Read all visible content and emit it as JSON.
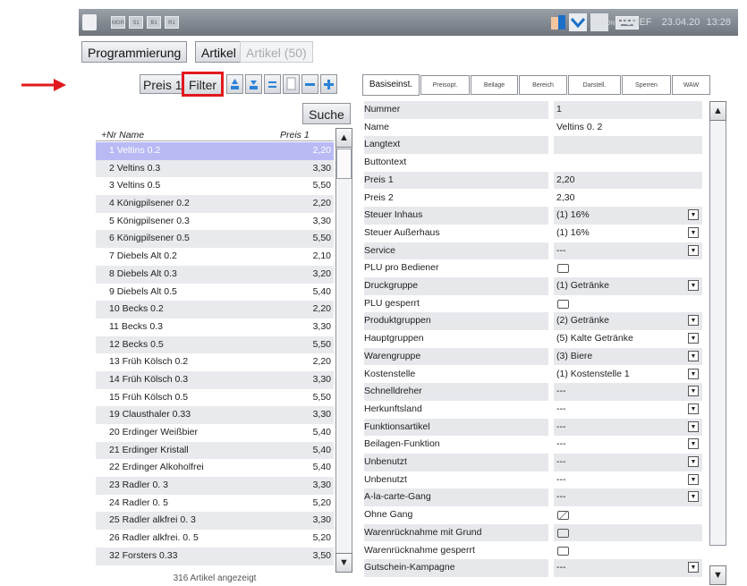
{
  "topbar": {
    "small_buttons": [
      "MGR",
      "S1",
      "B1",
      "R1"
    ],
    "net_label": "NET ON",
    "user": "CHEF",
    "date": "23.04.20",
    "time": "13:28"
  },
  "tabs": {
    "programmierung": "Programmierung",
    "artikel": "Artikel",
    "artikel_count": "Artikel (50)"
  },
  "toolbar": {
    "preis_label": "Preis 1",
    "filter_label": "Filter",
    "search_label": "Suche"
  },
  "list": {
    "col_nr_name": "+Nr Name",
    "col_price": "Preis 1",
    "items": [
      {
        "text": "1 Veltins 0.2",
        "price": "2,20"
      },
      {
        "text": "2 Veltins 0.3",
        "price": "3,30"
      },
      {
        "text": "3 Veltins 0.5",
        "price": "5,50"
      },
      {
        "text": "4 Königpilsener 0.2",
        "price": "2,20"
      },
      {
        "text": "5 Königpilsener 0.3",
        "price": "3,30"
      },
      {
        "text": "6 Königpilsener 0.5",
        "price": "5,50"
      },
      {
        "text": "7 Diebels Alt 0.2",
        "price": "2,10"
      },
      {
        "text": "8 Diebels Alt 0.3",
        "price": "3,20"
      },
      {
        "text": "9 Diebels Alt 0.5",
        "price": "5,40"
      },
      {
        "text": "10 Becks 0.2",
        "price": "2,20"
      },
      {
        "text": "11 Becks 0.3",
        "price": "3,30"
      },
      {
        "text": "12 Becks 0.5",
        "price": "5,50"
      },
      {
        "text": "13 Früh Kölsch 0.2",
        "price": "2,20"
      },
      {
        "text": "14 Früh Kölsch 0.3",
        "price": "3,30"
      },
      {
        "text": "15 Früh Kölsch 0.5",
        "price": "5,50"
      },
      {
        "text": "19 Clausthaler 0.33",
        "price": "3,30"
      },
      {
        "text": "20 Erdinger Weißbier",
        "price": "5,40"
      },
      {
        "text": "21 Erdinger Kristall",
        "price": "5,40"
      },
      {
        "text": "22 Erdinger Alkoholfrei",
        "price": "5,40"
      },
      {
        "text": "23 Radler 0. 3",
        "price": "3,30"
      },
      {
        "text": "24 Radler 0. 5",
        "price": "5,20"
      },
      {
        "text": "25 Radler alkfrei 0. 3",
        "price": "3,30"
      },
      {
        "text": "26 Radler alkfrei. 0. 5",
        "price": "5,20"
      },
      {
        "text": "32 Forsters 0.33",
        "price": "3,50"
      }
    ],
    "footer": "316 Artikel angezeigt"
  },
  "detail": {
    "tabs": [
      "Basiseinst.",
      "Preisopt.",
      "Beilage",
      "Bereich",
      "Darstell.",
      "Sperren",
      "WAW"
    ],
    "rows": [
      {
        "label": "Nummer",
        "value": "1",
        "type": "text"
      },
      {
        "label": "Name",
        "value": "Veltins 0. 2",
        "type": "text"
      },
      {
        "label": "Langtext",
        "value": "",
        "type": "text"
      },
      {
        "label": "Buttontext",
        "value": "",
        "type": "text"
      },
      {
        "label": "Preis 1",
        "value": "2,20",
        "type": "text"
      },
      {
        "label": "Preis 2",
        "value": "2,30",
        "type": "text"
      },
      {
        "label": "Steuer Inhaus",
        "value": "(1) 16%",
        "type": "dropdown"
      },
      {
        "label": "Steuer Außerhaus",
        "value": "(1) 16%",
        "type": "dropdown"
      },
      {
        "label": "Service",
        "value": "---",
        "type": "dropdown"
      },
      {
        "label": "PLU pro Bediener",
        "value": "",
        "type": "checkbox"
      },
      {
        "label": "Druckgruppe",
        "value": "(1) Getränke",
        "type": "dropdown"
      },
      {
        "label": "PLU gesperrt",
        "value": "",
        "type": "checkbox"
      },
      {
        "label": "Produktgruppen",
        "value": "(2) Getränke",
        "type": "dropdown"
      },
      {
        "label": "Hauptgruppen",
        "value": "(5) Kalte Getränke",
        "type": "dropdown"
      },
      {
        "label": "Warengruppe",
        "value": "(3) Biere",
        "type": "dropdown"
      },
      {
        "label": "Kostenstelle",
        "value": "(1) Kostenstelle 1",
        "type": "dropdown"
      },
      {
        "label": "Schnelldreher",
        "value": "---",
        "type": "dropdown"
      },
      {
        "label": "Herkunftsland",
        "value": "---",
        "type": "dropdown"
      },
      {
        "label": "Funktionsartikel",
        "value": "---",
        "type": "dropdown"
      },
      {
        "label": "Beilagen-Funktion",
        "value": "---",
        "type": "dropdown"
      },
      {
        "label": "Unbenutzt",
        "value": "---",
        "type": "dropdown"
      },
      {
        "label": "Unbenutzt",
        "value": "---",
        "type": "dropdown"
      },
      {
        "label": "A-la-carte-Gang",
        "value": "---",
        "type": "dropdown"
      },
      {
        "label": "Ohne Gang",
        "value": "checked",
        "type": "checkbox"
      },
      {
        "label": "Warenrücknahme mit Grund",
        "value": "",
        "type": "checkbox"
      },
      {
        "label": "Warenrücknahme gesperrt",
        "value": "",
        "type": "checkbox"
      },
      {
        "label": "Gutschein-Kampagne",
        "value": "---",
        "type": "dropdown"
      }
    ]
  },
  "colors": {
    "selected_row": "#b9baf4",
    "highlight": "#e0191d",
    "topbar": "#7d838b"
  }
}
